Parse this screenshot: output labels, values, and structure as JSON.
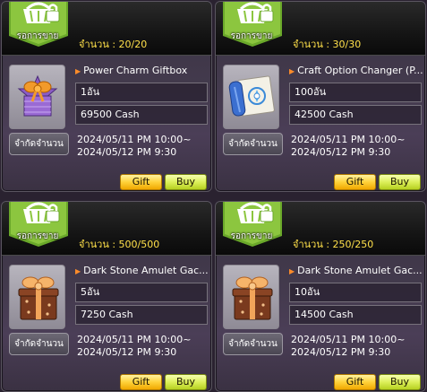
{
  "colors": {
    "qty_text": "#ffe04a",
    "name_arrow": "#ff8c2a",
    "gift_button": "#ffd23a",
    "buy_button": "#dcf05a",
    "basket_green": "#8cc63f"
  },
  "cards": [
    {
      "sale_label": "รอการขาย",
      "quantity_label": "จำนวน :",
      "quantity_value": "20/20",
      "item_icon": "gift-box-purple-icon",
      "item_name": "Power Charm Giftbox",
      "amount": "1อัน",
      "price": "69500 Cash",
      "limit_button": "จำกัดจำนวน",
      "period_start": "2024/05/11 PM 10:00~",
      "period_end": "2024/05/12 PM 9:30",
      "gift_label": "Gift",
      "buy_label": "Buy"
    },
    {
      "sale_label": "รอการขาย",
      "quantity_label": "จำนวน :",
      "quantity_value": "30/30",
      "item_icon": "scroll-icon",
      "item_name": "Craft Option Changer (P...",
      "amount": "100อัน",
      "price": "42500 Cash",
      "limit_button": "จำกัดจำนวน",
      "period_start": "2024/05/11 PM 10:00~",
      "period_end": "2024/05/12 PM 9:30",
      "gift_label": "Gift",
      "buy_label": "Buy"
    },
    {
      "sale_label": "รอการขาย",
      "quantity_label": "จำนวน :",
      "quantity_value": "500/500",
      "item_icon": "gift-box-brown-icon",
      "item_name": "Dark Stone Amulet Gac...",
      "amount": "5อัน",
      "price": "7250 Cash",
      "limit_button": "จำกัดจำนวน",
      "period_start": "2024/05/11 PM 10:00~",
      "period_end": "2024/05/12 PM 9:30",
      "gift_label": "Gift",
      "buy_label": "Buy"
    },
    {
      "sale_label": "รอการขาย",
      "quantity_label": "จำนวน :",
      "quantity_value": "250/250",
      "item_icon": "gift-box-brown-icon",
      "item_name": "Dark Stone Amulet Gac...",
      "amount": "10อัน",
      "price": "14500 Cash",
      "limit_button": "จำกัดจำนวน",
      "period_start": "2024/05/11 PM 10:00~",
      "period_end": "2024/05/12 PM 9:30",
      "gift_label": "Gift",
      "buy_label": "Buy"
    }
  ]
}
